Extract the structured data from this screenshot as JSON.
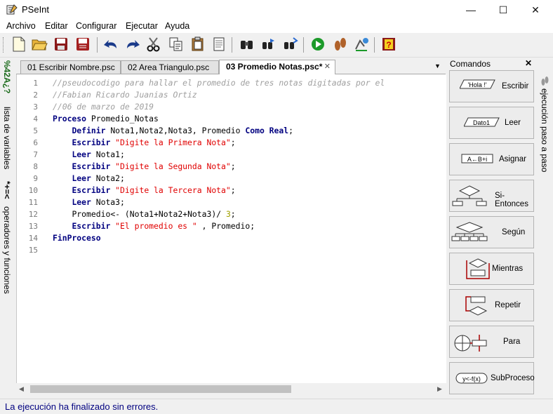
{
  "window": {
    "title": "PSeInt",
    "min_glyph": "—",
    "max_glyph": "☐",
    "close_glyph": "✕"
  },
  "menu": [
    "Archivo",
    "Editar",
    "Configurar",
    "Ejecutar",
    "Ayuda"
  ],
  "toolbar": {
    "icons": [
      "new-file-icon",
      "open-folder-icon",
      "save-icon",
      "save-as-icon",
      "undo-icon",
      "redo-icon",
      "cut-icon",
      "copy-icon",
      "paste-icon",
      "edit-icon",
      "find-icon",
      "find-next-icon",
      "replace-icon",
      "run-icon",
      "step-by-step-icon",
      "debug-icon",
      "help-icon"
    ]
  },
  "left_strip": {
    "variables_label": "lista de variables",
    "operators_label": "operadores y funciones",
    "operators_symbols": "*+=<",
    "variables_symbols": "%42A¿?"
  },
  "tabs": [
    {
      "label": "01 Escribir Nombre.psc",
      "active": false
    },
    {
      "label": "02 Area Triangulo.psc",
      "active": false
    },
    {
      "label": "03 Promedio Notas.psc*",
      "active": true
    }
  ],
  "editor": {
    "line_numbers": [
      "1",
      "2",
      "3",
      "4",
      "5",
      "6",
      "7",
      "8",
      "9",
      "10",
      "11",
      "12",
      "13",
      "14",
      "15"
    ],
    "lines": [
      "//pseudocodigo para hallar el promedio de tres notas digitadas por el",
      "//Fabian Ricardo Juanias Ortiz",
      "//06 de marzo de 2019",
      "Proceso Promedio_Notas",
      "    Definir Nota1,Nota2,Nota3, Promedio Como Real;",
      "    Escribir \"Digite la Primera Nota\";",
      "    Leer Nota1;",
      "    Escribir \"Digite la Segunda Nota\";",
      "    Leer Nota2;",
      "    Escribir \"Digite la Tercera Nota\";",
      "    Leer Nota3;",
      "    Promedio<- (Nota1+Nota2+Nota3)/ 3;",
      "    Escribir \"El promedio es \" , Promedio;",
      "FinProceso",
      ""
    ]
  },
  "commands": {
    "title": "Comandos",
    "close_glyph": "✕",
    "items": [
      {
        "label": "Escribir",
        "icon_text": "'Hola !'"
      },
      {
        "label": "Leer",
        "icon_text": "Dato1"
      },
      {
        "label": "Asignar",
        "icon_text": "A←B+i"
      },
      {
        "label": "Si-Entonces",
        "icon_text": ""
      },
      {
        "label": "Según",
        "icon_text": ""
      },
      {
        "label": "Mientras",
        "icon_text": ""
      },
      {
        "label": "Repetir",
        "icon_text": ""
      },
      {
        "label": "Para",
        "icon_text": ""
      },
      {
        "label": "SubProceso",
        "icon_text": "y<-f(x)"
      }
    ]
  },
  "right_strip": {
    "label": "ejecución paso a paso"
  },
  "status": "La ejecución ha finalizado sin errores.",
  "colors": {
    "keyword": "#000080",
    "string": "#e00000",
    "comment": "#a0a0a0",
    "number": "#a0a000",
    "status": "#000080"
  }
}
